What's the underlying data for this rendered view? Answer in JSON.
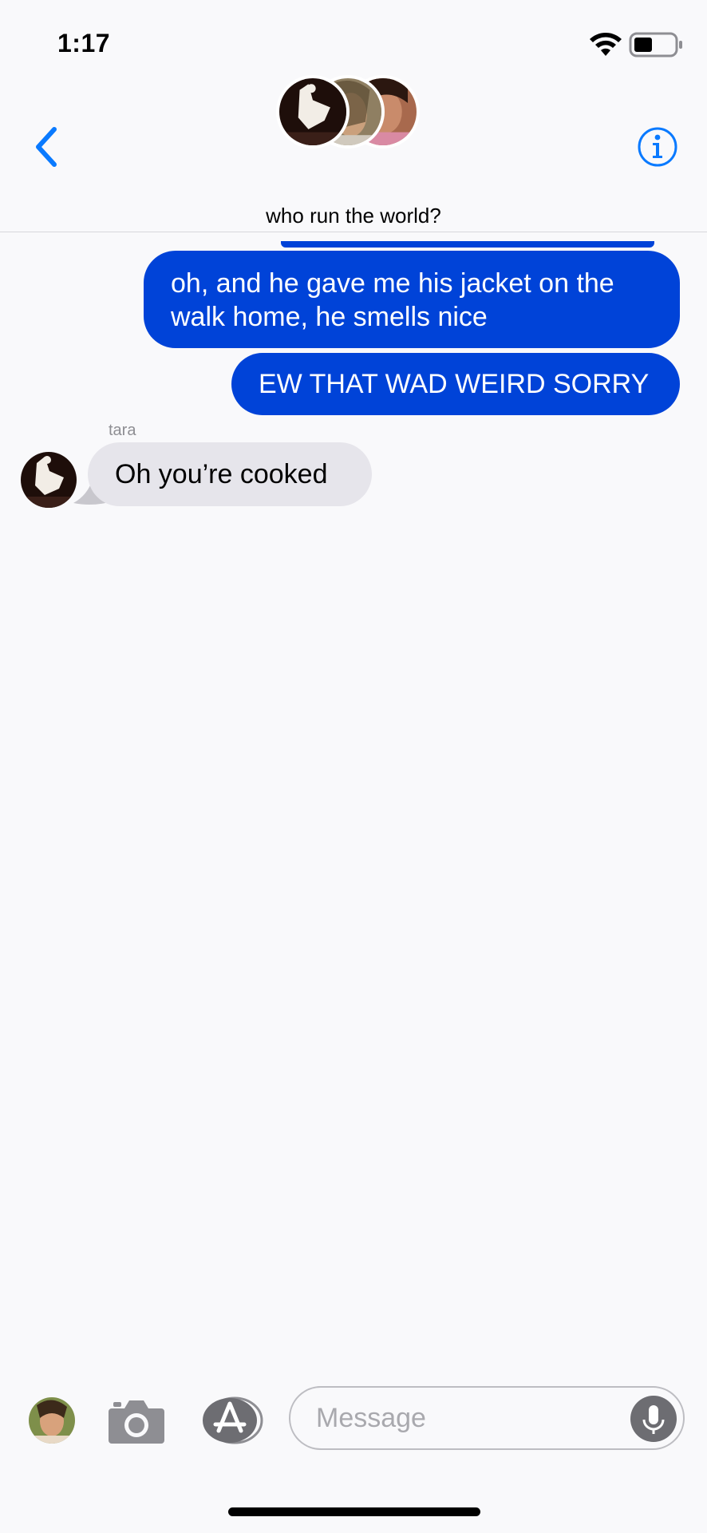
{
  "status_bar": {
    "time": "1:17",
    "icons": [
      "wifi-icon",
      "battery-icon"
    ]
  },
  "header": {
    "back_icon": "chevron-left-icon",
    "info_icon": "info-icon",
    "group_name": "who run the world?",
    "accent_color": "#0a7aff"
  },
  "messages": [
    {
      "direction": "outgoing",
      "text": "oh, and he gave me his jacket on the walk home, he smells nice"
    },
    {
      "direction": "outgoing",
      "text": "EW THAT WAD WEIRD SORRY"
    },
    {
      "direction": "incoming",
      "sender": "tara",
      "text": "Oh you’re cooked"
    }
  ],
  "colors": {
    "outgoing_bubble": "#0043d8",
    "incoming_bubble": "#e6e5eb",
    "background": "#f9f9fb"
  },
  "input_bar": {
    "placeholder": "Message",
    "icons": [
      "memoji-avatar",
      "camera-icon",
      "appstore-icon",
      "microphone-icon"
    ]
  }
}
